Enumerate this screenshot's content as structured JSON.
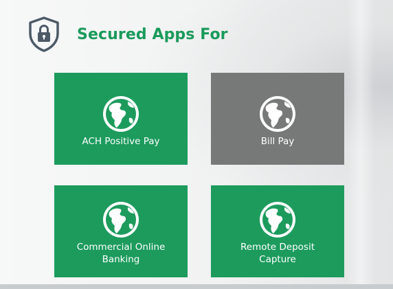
{
  "header": {
    "title": "Secured Apps For",
    "icon": "shield-lock-icon"
  },
  "tiles": [
    {
      "label_lines": [
        "ACH Positive Pay"
      ],
      "icon": "globe-icon",
      "color": "#1c9b5d",
      "state": "enabled"
    },
    {
      "label_lines": [
        "Bill Pay"
      ],
      "icon": "globe-icon",
      "color": "#777979",
      "state": "selected"
    },
    {
      "label_lines": [
        "Commercial Online",
        "Banking"
      ],
      "icon": "globe-icon",
      "color": "#1c9b5d",
      "state": "enabled"
    },
    {
      "label_lines": [
        "Remote Deposit",
        "Capture"
      ],
      "icon": "globe-icon",
      "color": "#1c9b5d",
      "state": "enabled"
    }
  ],
  "colors": {
    "accent": "#1a9a5b",
    "tile_green": "#1c9b5d",
    "tile_gray": "#777979",
    "shield": "#4d5a66"
  }
}
